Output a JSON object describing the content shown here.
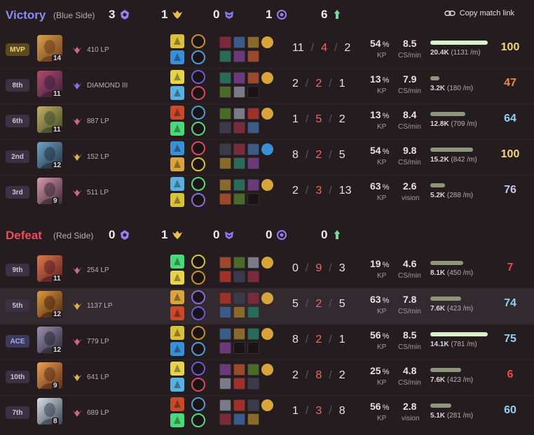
{
  "copy_link": "Copy match link",
  "colors": {
    "victory": "#8b8cf5",
    "defeat": "#ee4a5a",
    "score_gold": "#f3d77a",
    "score_orange": "#f08c3c",
    "score_blue": "#8fd3f0",
    "score_lavender": "#c9c3f5",
    "score_red": "#ee4a4a"
  },
  "teams": [
    {
      "result": "Victory",
      "side": "(Blue Side)",
      "objectives": [
        {
          "icon": "baron-icon",
          "value": "3"
        },
        {
          "icon": "dragon-icon",
          "value": "1"
        },
        {
          "icon": "herald-icon",
          "value": "0"
        },
        {
          "icon": "void-grub-icon",
          "value": "1"
        },
        {
          "icon": "tower-icon",
          "value": "6"
        }
      ],
      "players": [
        {
          "badge": "MVP",
          "badge_type": "mvp",
          "level": "14",
          "rank": "410 LP",
          "kills": "11",
          "deaths": "4",
          "assists": "2",
          "kp": "54",
          "cs": "8.5",
          "cs_label": "CS/min",
          "damage": "20.4K",
          "dpm": "(1131 /m)",
          "damage_ratio": 1.0,
          "score": "100",
          "score_color": "#f3d77a"
        },
        {
          "badge": "8th",
          "badge_type": "rank",
          "level": "11",
          "rank": "DIAMOND III",
          "kills": "2",
          "deaths": "2",
          "assists": "1",
          "kp": "13",
          "cs": "7.9",
          "cs_label": "CS/min",
          "damage": "3.2K",
          "dpm": "(180 /m)",
          "damage_ratio": 0.16,
          "score": "47",
          "score_color": "#f08c3c"
        },
        {
          "badge": "6th",
          "badge_type": "rank",
          "level": "11",
          "rank": "887 LP",
          "kills": "1",
          "deaths": "5",
          "assists": "2",
          "kp": "13",
          "cs": "8.4",
          "cs_label": "CS/min",
          "damage": "12.8K",
          "dpm": "(709 /m)",
          "damage_ratio": 0.61,
          "score": "64",
          "score_color": "#8fd3f0"
        },
        {
          "badge": "2nd",
          "badge_type": "rank",
          "level": "12",
          "rank": "152 LP",
          "kills": "8",
          "deaths": "2",
          "assists": "5",
          "kp": "54",
          "cs": "9.8",
          "cs_label": "CS/min",
          "damage": "15.2K",
          "dpm": "(842 /m)",
          "damage_ratio": 0.74,
          "score": "100",
          "score_color": "#f3d77a"
        },
        {
          "badge": "3rd",
          "badge_type": "rank",
          "level": "9",
          "rank": "511 LP",
          "kills": "2",
          "deaths": "3",
          "assists": "13",
          "kp": "63",
          "cs": "2.6",
          "cs_label": "vision",
          "damage": "5.2K",
          "dpm": "(288 /m)",
          "damage_ratio": 0.25,
          "score": "76",
          "score_color": "#c9c3f5"
        }
      ]
    },
    {
      "result": "Defeat",
      "side": "(Red Side)",
      "objectives": [
        {
          "icon": "baron-icon",
          "value": "0"
        },
        {
          "icon": "dragon-icon",
          "value": "1"
        },
        {
          "icon": "herald-icon",
          "value": "0"
        },
        {
          "icon": "void-grub-icon",
          "value": "0"
        },
        {
          "icon": "tower-icon",
          "value": "0"
        }
      ],
      "players": [
        {
          "badge": "9th",
          "badge_type": "rank",
          "level": "11",
          "rank": "254 LP",
          "kills": "0",
          "deaths": "9",
          "assists": "3",
          "kp": "19",
          "cs": "4.6",
          "cs_label": "CS/min",
          "damage": "8.1K",
          "dpm": "(450 /m)",
          "damage_ratio": 0.57,
          "score": "7",
          "score_color": "#ee4a4a"
        },
        {
          "badge": "5th",
          "badge_type": "rank",
          "level": "12",
          "rank": "1137 LP",
          "kills": "5",
          "deaths": "2",
          "assists": "5",
          "kp": "63",
          "cs": "7.8",
          "cs_label": "CS/min",
          "damage": "7.6K",
          "dpm": "(423 /m)",
          "damage_ratio": 0.54,
          "score": "74",
          "score_color": "#8fd3f0"
        },
        {
          "badge": "ACE",
          "badge_type": "ace",
          "level": "12",
          "rank": "779 LP",
          "kills": "8",
          "deaths": "2",
          "assists": "1",
          "kp": "56",
          "cs": "8.5",
          "cs_label": "CS/min",
          "damage": "14.1K",
          "dpm": "(781 /m)",
          "damage_ratio": 1.0,
          "score": "75",
          "score_color": "#8fd3f0"
        },
        {
          "badge": "10th",
          "badge_type": "rank",
          "level": "9",
          "rank": "641 LP",
          "kills": "2",
          "deaths": "8",
          "assists": "2",
          "kp": "25",
          "cs": "4.8",
          "cs_label": "CS/min",
          "damage": "7.6K",
          "dpm": "(423 /m)",
          "damage_ratio": 0.54,
          "score": "6",
          "score_color": "#ee4a4a"
        },
        {
          "badge": "7th",
          "badge_type": "rank",
          "level": "8",
          "rank": "689 LP",
          "kills": "1",
          "deaths": "3",
          "assists": "8",
          "kp": "56",
          "cs": "2.8",
          "cs_label": "vision",
          "damage": "5.1K",
          "dpm": "(281 /m)",
          "damage_ratio": 0.36,
          "score": "60",
          "score_color": "#8fd3f0"
        }
      ]
    }
  ]
}
